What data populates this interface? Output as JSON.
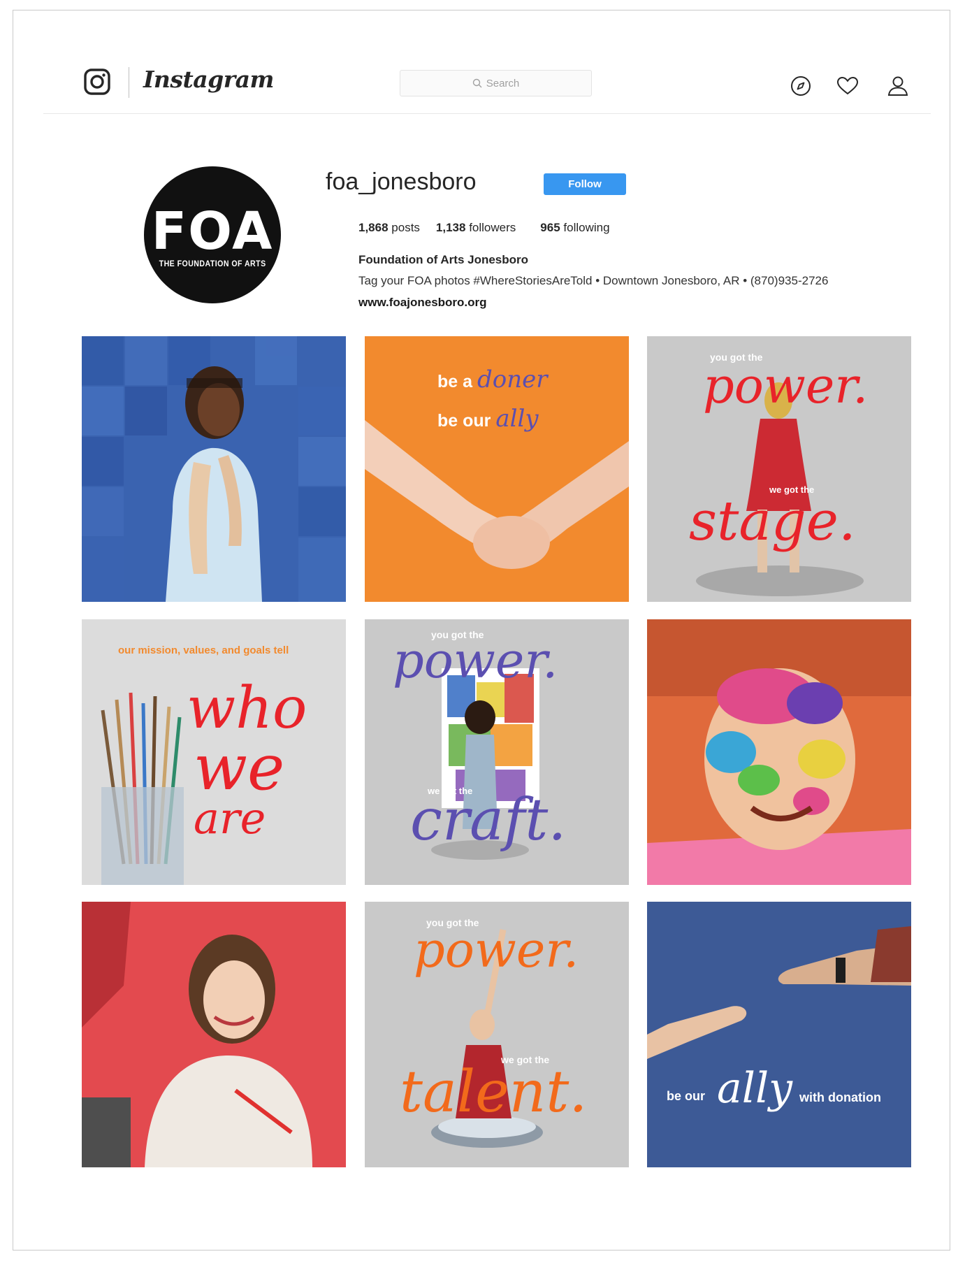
{
  "header": {
    "wordmark": "Instagram",
    "search_placeholder": "Search",
    "icons": [
      "instagram-glyph-icon",
      "compass-icon",
      "heart-icon",
      "person-icon"
    ]
  },
  "profile": {
    "username": "foa_jonesboro",
    "follow_label": "Follow",
    "avatar_mark": "FOA",
    "avatar_subtitle": "THE FOUNDATION OF ARTS",
    "stats": {
      "posts_count": "1,868",
      "posts_label": "posts",
      "followers_count": "1,138",
      "followers_label": "followers",
      "following_count": "965",
      "following_label": "following"
    },
    "full_name": "Foundation of Arts Jonesboro",
    "bio": "Tag your FOA photos #WhereStoriesAreTold • Downtown Jonesboro, AR • (870)935-2726",
    "website": "www.foajonesboro.org"
  },
  "posts": {
    "p2": {
      "line1a": "be a",
      "line1b": "doner",
      "line2a": "be our",
      "line2b": "ally"
    },
    "p3": {
      "top": "you got the",
      "big1": "power.",
      "mid": "we got the",
      "big2": "stage."
    },
    "p4": {
      "top": "our mission, values, and goals tell",
      "w1": "who",
      "w2": "we",
      "w3": "are"
    },
    "p5": {
      "top": "you got the",
      "big1": "power.",
      "mid": "we got the",
      "big2": "craft."
    },
    "p8": {
      "top": "you got the",
      "big1": "power.",
      "mid": "we got the",
      "big2": "talent."
    },
    "p9": {
      "a": "be our",
      "b": "ally",
      "c": "with donation"
    }
  },
  "colors": {
    "follow_blue": "#3897f0",
    "orange": "#f28a2e",
    "red_script": "#e8232a",
    "purple_script": "#5b4fb0",
    "orange_script": "#f26a1b",
    "navy": "#3d5a96",
    "gray_bg": "#c9c9c9"
  }
}
